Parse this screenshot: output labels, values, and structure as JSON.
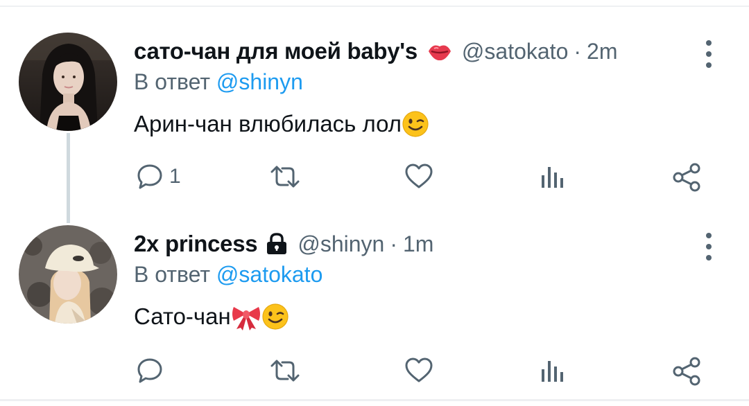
{
  "tweets": [
    {
      "name": "сато-чан для моей baby's",
      "badge_icon": "kiss-lips-emoji",
      "handle": "@satokato",
      "time": "2m",
      "reply_prefix": "В ответ",
      "reply_handle": "@shinyn",
      "text": "Арин-чан влюбилась лол",
      "text_emojis": [
        "winking-face-emoji"
      ],
      "reply_count": "1"
    },
    {
      "name": "2x princess",
      "badge_icon": "lock-icon",
      "handle": "@shinyn",
      "time": "1m",
      "reply_prefix": "В ответ",
      "reply_handle": "@satokato",
      "text": "Сато-чан",
      "text_emojis": [
        "ribbon-emoji",
        "winking-face-emoji"
      ],
      "reply_count": ""
    }
  ],
  "colors": {
    "text_primary": "#0f1419",
    "text_secondary": "#536471",
    "mention": "#1d9bf0",
    "divider": "#eef0f2",
    "thread_line": "#cfd9de"
  }
}
